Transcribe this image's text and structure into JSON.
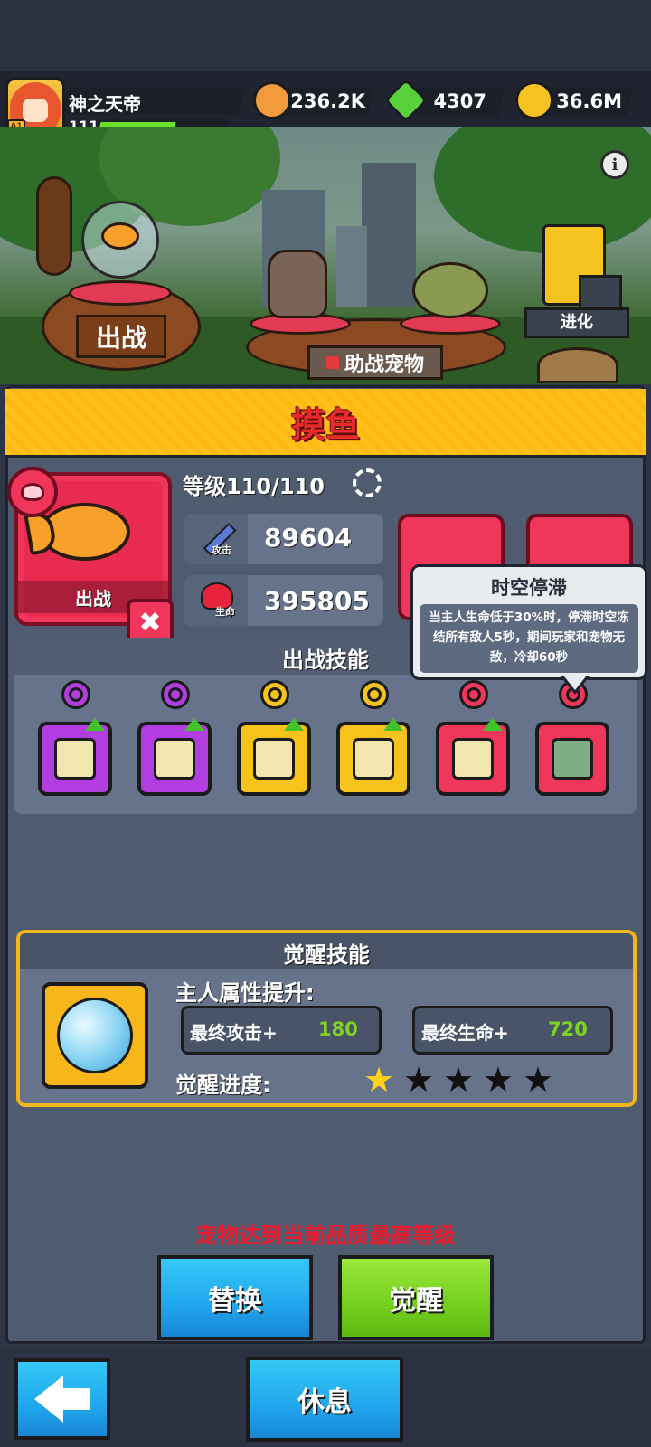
{
  "player": {
    "name": "神之天帝",
    "level": "111",
    "rank_badge": "A1",
    "xp_fraction": 0.6
  },
  "resources": [
    {
      "name": "pet-food",
      "icon": "dog-coin-icon",
      "value": "236.2K",
      "color": "#f39a3c"
    },
    {
      "name": "gems",
      "icon": "green-gem-plus-icon",
      "value": "4307",
      "color": "#58d13a"
    },
    {
      "name": "gold",
      "icon": "gold-coin-plus-icon",
      "value": "36.6M",
      "color": "#f6c21f"
    }
  ],
  "scene": {
    "deploy_sign": "出战",
    "assist_sign": "助战宠物",
    "evolve_label": "进化"
  },
  "pet": {
    "name": "摸鱼",
    "level_text": "等级110/110",
    "card_label": "出战",
    "attack_sub": "攻击",
    "attack": "89604",
    "hp_sub": "生命",
    "hp": "395805"
  },
  "tooltip": {
    "title": "时空停滞",
    "description": "当主人生命低于30%时，停滞时空冻结所有敌人5秒，期间玩家和宠物无敌，冷却60秒"
  },
  "battle_skills": {
    "title": "出战技能",
    "skills": [
      {
        "icon": "card-upgrade-icon",
        "frame_color": "#b23de0",
        "dot_color": "#b23de0"
      },
      {
        "icon": "shield-upgrade-icon",
        "frame_color": "#b23de0",
        "dot_color": "#b23de0"
      },
      {
        "icon": "shield-lock-upgrade-icon",
        "frame_color": "#f7c21a",
        "dot_color": "#f7c21a"
      },
      {
        "icon": "paw-upgrade-icon",
        "frame_color": "#f7c21a",
        "dot_color": "#f7c21a"
      },
      {
        "icon": "chest-gear-upgrade-icon",
        "frame_color": "#f0365a",
        "dot_color": "#f0365a"
      },
      {
        "icon": "frozen-zombie-icon",
        "frame_color": "#f0365a",
        "dot_color": "#f0365a"
      }
    ]
  },
  "awaken": {
    "title": "觉醒技能",
    "attr_title": "主人属性提升:",
    "attack_label": "最终攻击+",
    "attack_value": "180",
    "hp_label": "最终生命+",
    "hp_value": "720",
    "progress_label": "觉醒进度:",
    "stars_filled": 1,
    "stars_total": 5
  },
  "max_notice": "宠物达到当前品质最高等级",
  "buttons": {
    "replace": "替换",
    "awaken": "觉醒",
    "rest": "休息"
  }
}
